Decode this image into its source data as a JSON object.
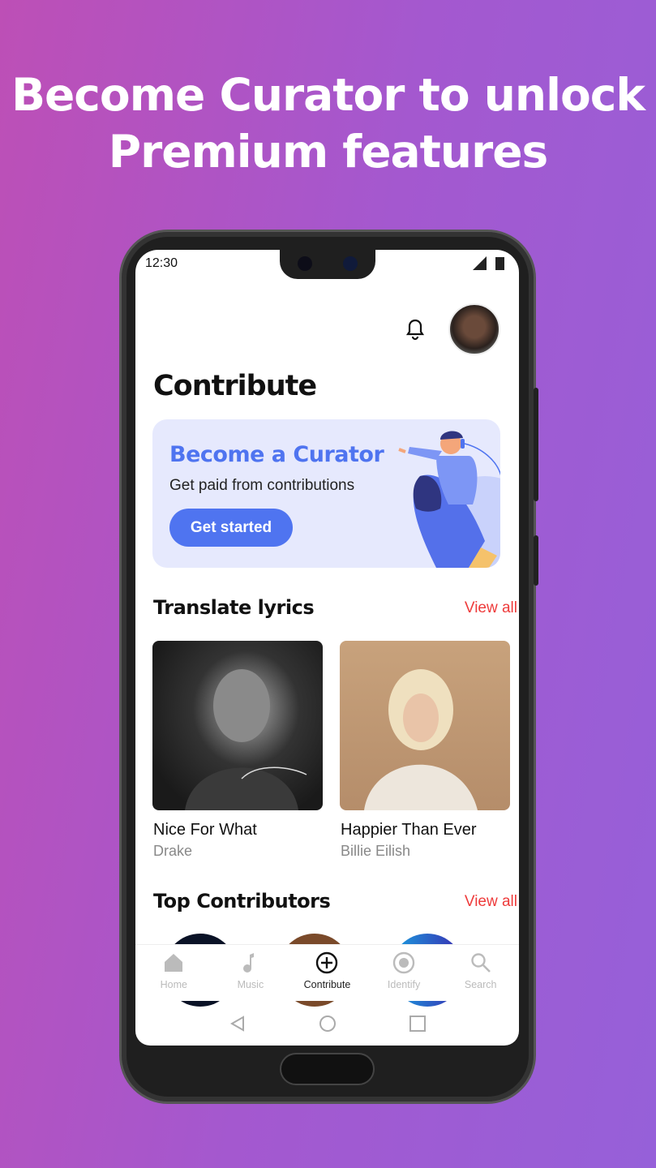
{
  "headline": {
    "line1": "Become Curator to unlock",
    "line2": "Premium features"
  },
  "status": {
    "time": "12:30"
  },
  "header": {
    "icons": [
      "bell-icon",
      "avatar"
    ]
  },
  "page_title": "Contribute",
  "banner": {
    "title": "Become a Curator",
    "subtitle": "Get paid from contributions",
    "button": "Get started",
    "accent": "#4f74f0"
  },
  "translate": {
    "title": "Translate lyrics",
    "view_all": "View all",
    "items": [
      {
        "title": "Nice For What",
        "artist": "Drake"
      },
      {
        "title": "Happier Than Ever",
        "artist": "Billie Eilish"
      }
    ]
  },
  "contributors": {
    "title": "Top Contributors",
    "view_all": "View all"
  },
  "nav": {
    "items": [
      {
        "label": "Home",
        "icon": "home-icon"
      },
      {
        "label": "Music",
        "icon": "music-note-icon"
      },
      {
        "label": "Contribute",
        "icon": "plus-circle-icon",
        "active": true
      },
      {
        "label": "Identify",
        "icon": "record-icon"
      },
      {
        "label": "Search",
        "icon": "search-icon"
      }
    ]
  },
  "system_nav": [
    "back-icon",
    "home-circle-icon",
    "recents-icon"
  ]
}
